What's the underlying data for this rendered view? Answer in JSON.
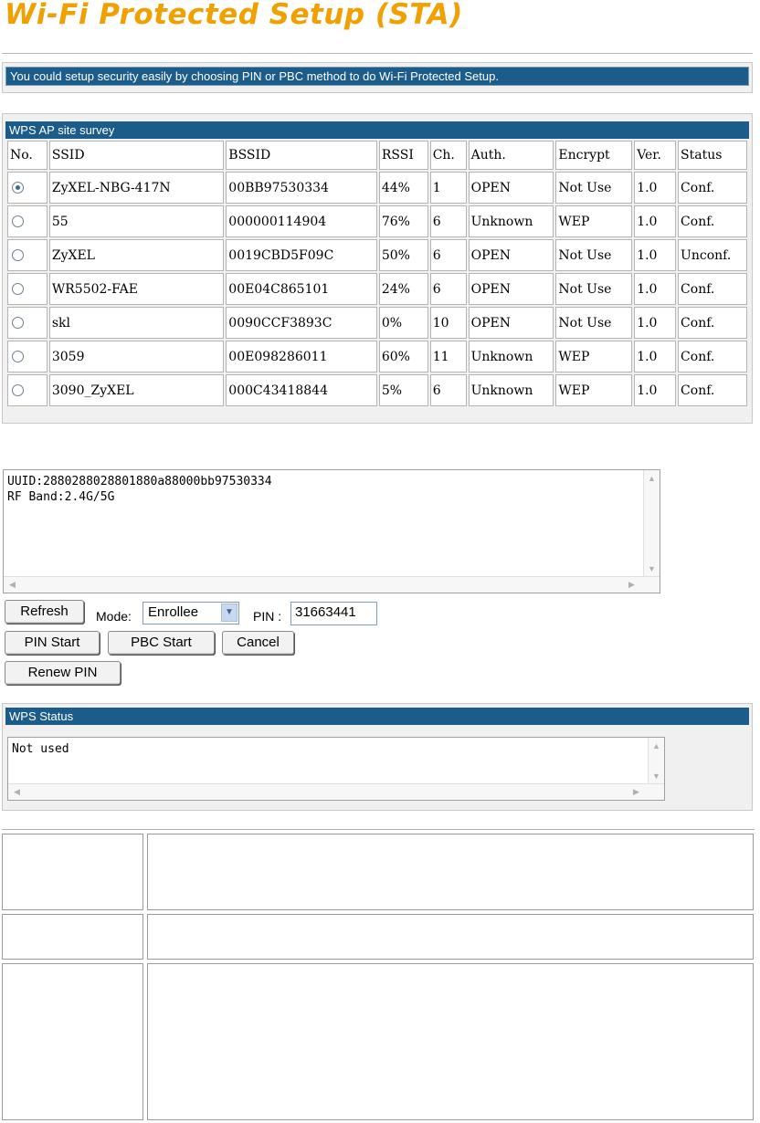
{
  "title": "Wi-Fi Protected Setup (STA)",
  "info_text": "You could setup security easily by choosing PIN or PBC method to do Wi-Fi Protected Setup.",
  "survey": {
    "heading": "WPS AP site survey",
    "columns": [
      "No.",
      "SSID",
      "BSSID",
      "RSSI",
      "Ch.",
      "Auth.",
      "Encrypt",
      "Ver.",
      "Status"
    ],
    "rows": [
      {
        "selected": true,
        "ssid": "ZyXEL-NBG-417N",
        "bssid": "00BB97530334",
        "rssi": "44%",
        "ch": "1",
        "auth": "OPEN",
        "encrypt": "Not Use",
        "ver": "1.0",
        "status": "Conf."
      },
      {
        "selected": false,
        "ssid": "55",
        "bssid": "000000114904",
        "rssi": "76%",
        "ch": "6",
        "auth": "Unknown",
        "encrypt": "WEP",
        "ver": "1.0",
        "status": "Conf."
      },
      {
        "selected": false,
        "ssid": "ZyXEL",
        "bssid": "0019CBD5F09C",
        "rssi": "50%",
        "ch": "6",
        "auth": "OPEN",
        "encrypt": "Not Use",
        "ver": "1.0",
        "status": "Unconf."
      },
      {
        "selected": false,
        "ssid": "WR5502-FAE",
        "bssid": "00E04C865101",
        "rssi": "24%",
        "ch": "6",
        "auth": "OPEN",
        "encrypt": "Not Use",
        "ver": "1.0",
        "status": "Conf."
      },
      {
        "selected": false,
        "ssid": "skl",
        "bssid": "0090CCF3893C",
        "rssi": "0%",
        "ch": "10",
        "auth": "OPEN",
        "encrypt": "Not Use",
        "ver": "1.0",
        "status": "Conf."
      },
      {
        "selected": false,
        "ssid": "3059",
        "bssid": "00E098286011",
        "rssi": "60%",
        "ch": "11",
        "auth": "Unknown",
        "encrypt": "WEP",
        "ver": "1.0",
        "status": "Conf."
      },
      {
        "selected": false,
        "ssid": "3090_ZyXEL",
        "bssid": "000C43418844",
        "rssi": "5%",
        "ch": "6",
        "auth": "Unknown",
        "encrypt": "WEP",
        "ver": "1.0",
        "status": "Conf."
      }
    ]
  },
  "details": {
    "uuid_line": "UUID:2880288028801880a88000bb97530334",
    "rf_line": "RF Band:2.4G/5G"
  },
  "controls": {
    "refresh_label": "Refresh",
    "mode_label": "Mode:",
    "mode_value": "Enrollee",
    "pin_label": "PIN :",
    "pin_value": "31663441",
    "pin_start_label": "PIN Start",
    "pbc_start_label": "PBC Start",
    "cancel_label": "Cancel",
    "renew_pin_label": "Renew PIN"
  },
  "status": {
    "heading": "WPS Status",
    "text": "Not used"
  },
  "colors": {
    "title": "#f0a000",
    "header_bar": "#1c5c8a"
  }
}
